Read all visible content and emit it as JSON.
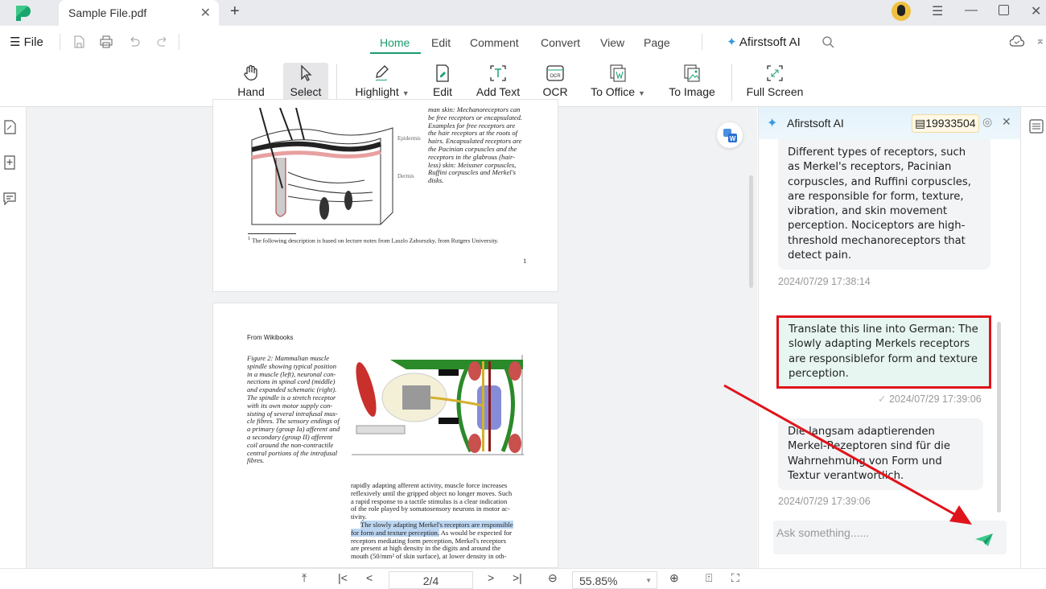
{
  "window": {
    "tab_title": "Sample File.pdf"
  },
  "menu": {
    "file": "File",
    "tabs": [
      "Home",
      "Edit",
      "Comment",
      "Convert",
      "View",
      "Page"
    ],
    "active_tab": "Home",
    "ai_label": "Afirstsoft AI"
  },
  "toolbar": {
    "hand": "Hand",
    "select": "Select",
    "highlight": "Highlight",
    "edit": "Edit",
    "add_text": "Add Text",
    "ocr": "OCR",
    "to_office": "To Office",
    "to_image": "To Image",
    "full_screen": "Full Screen",
    "ocr_icon_text": "OCR"
  },
  "document": {
    "page1": {
      "right_column": [
        "man skin: Mechanoreceptors can",
        "be free receptors or encapsulated.",
        "Examples for free receptors are",
        "the hair receptors at the roots of",
        "hairs. Encapsulated receptors are",
        "the Pacinian corpuscles and the",
        "receptors in the glabrous (hair-",
        "less) skin: Meissner corpuscles,",
        "Ruffini corpuscles and Merkel's",
        "disks."
      ],
      "figure_labels": {
        "epidermis": "Epidermis",
        "dermis": "Dermis"
      },
      "footnote_mark": "1",
      "footnote": "The following description is based on lecture notes from Laszlo Zaborszky, from Rutgers University.",
      "page_number": "1"
    },
    "page2": {
      "source": "From Wikibooks",
      "caption": [
        "Figure 2:  Mammalian muscle",
        "spindle showing typical position",
        "in a muscle (left), neuronal con-",
        "nections in spinal cord (middle)",
        "and expanded schematic (right).",
        "The spindle is a stretch receptor",
        "with its own motor supply con-",
        "sisting of several intrafusal mus-",
        "cle fibres. The sensory endings of",
        "a primary (group Ia) afferent and",
        "a secondary (group II) afferent",
        "coil around the non-contractile",
        "central portions of the intrafusal",
        "fibres."
      ],
      "body": [
        "rapidly adapting afferent activity, muscle force increases",
        "reflexively until the gripped object no longer moves. Such",
        "a rapid response to a tactile stimulus is a clear indication",
        "of the role played by somatosensory neurons in motor ac-",
        "tivity."
      ],
      "highlight_1": "The slowly adapting Merkel's receptors are responsible",
      "highlight_2": "for form and texture perception.",
      "after_highlight": " As would be expected for",
      "body2": [
        "receptors mediating form perception, Merkel's receptors",
        "are present at high density in the digits and around the",
        "mouth (50/mm² of skin surface), at lower density in oth-"
      ]
    }
  },
  "bottombar": {
    "page": "2/4",
    "zoom": "55.85%"
  },
  "ai_panel": {
    "title": "Afirstsoft AI",
    "credits": "19933504",
    "messages": [
      {
        "role": "assistant",
        "text": "Different types of receptors, such as Merkel's receptors, Pacinian corpuscles, and Ruffini corpuscles, are responsible for form, texture, vibration, and skin movement perception. Nociceptors are high-threshold mechanoreceptors that detect pain.",
        "time": "2024/07/29 17:38:14"
      },
      {
        "role": "user",
        "text": "Translate this line into German: The slowly adapting Merkels receptors are responsiblefor form and texture perception.",
        "time": "2024/07/29 17:39:06"
      },
      {
        "role": "assistant",
        "text": "Die langsam adaptierenden Merkel-Rezeptoren sind für die Wahrnehmung von Form und Textur verantwortlich.",
        "time": "2024/07/29 17:39:06"
      }
    ],
    "input_placeholder": "Ask something......"
  },
  "colors": {
    "accent": "#1a9b6c",
    "annotation": "#e0141b",
    "user_bubble": "#e7f6f1"
  }
}
